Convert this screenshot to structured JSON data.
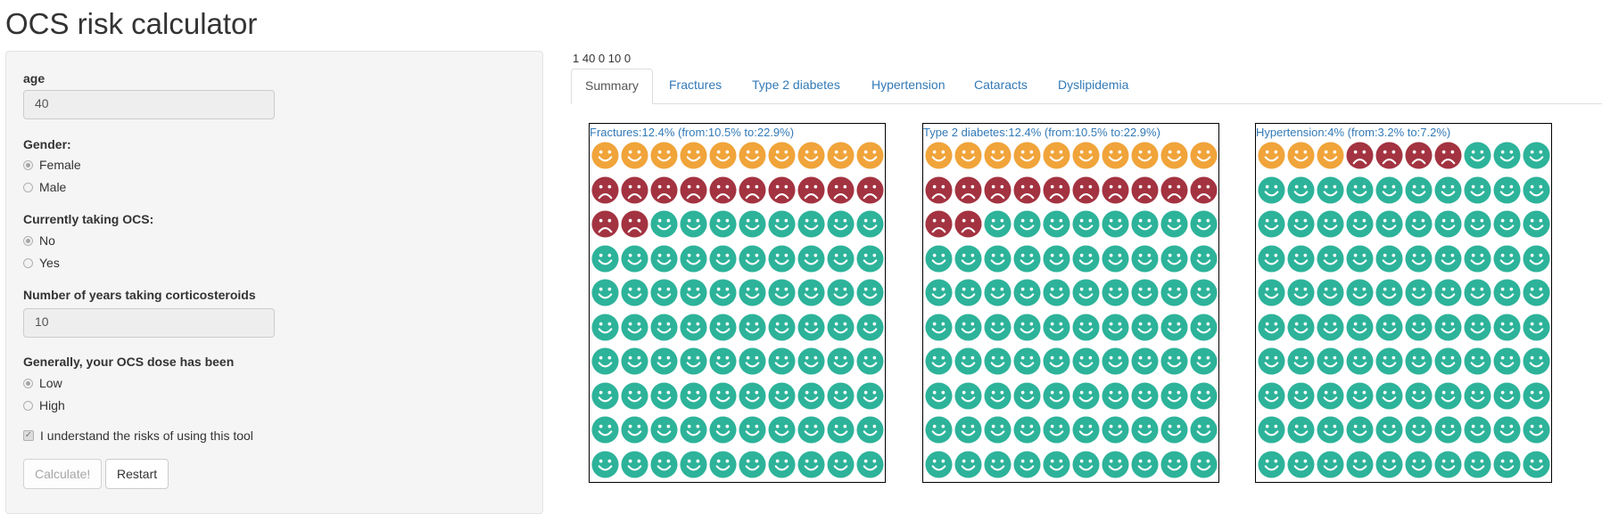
{
  "app": {
    "title": "OCS risk calculator"
  },
  "sidebar": {
    "age_label": "age",
    "age_value": "40",
    "gender_label": "Gender:",
    "gender_options": [
      "Female",
      "Male"
    ],
    "gender_selected": "Female",
    "ocs_label": "Currently taking OCS:",
    "ocs_options": [
      "No",
      "Yes"
    ],
    "ocs_selected": "No",
    "years_label": "Number of years taking corticosteroids",
    "years_value": "10",
    "dose_label": "Generally, your OCS dose has been",
    "dose_options": [
      "Low",
      "High"
    ],
    "dose_selected": "Low",
    "understand_label": "I understand the risks of using this tool",
    "understand_checked": true,
    "calculate_label": "Calculate!",
    "restart_label": "Restart"
  },
  "debug_text": "1 40 0 10 0",
  "tabs": [
    "Summary",
    "Fractures",
    "Type 2 diabetes",
    "Hypertension",
    "Cataracts",
    "Dyslipidemia"
  ],
  "active_tab": "Summary",
  "colors": {
    "orange": "#f0a43a",
    "red": "#a33340",
    "green": "#2db39a"
  },
  "panels": [
    {
      "title": "Fractures:12.4% (from:10.5% to:22.9%)",
      "orange": 10,
      "red": 12
    },
    {
      "title": "Type 2 diabetes:12.4% (from:10.5% to:22.9%)",
      "orange": 10,
      "red": 12
    },
    {
      "title": "Hypertension:4% (from:3.2% to:7.2%)",
      "orange": 3,
      "red": 4
    }
  ]
}
